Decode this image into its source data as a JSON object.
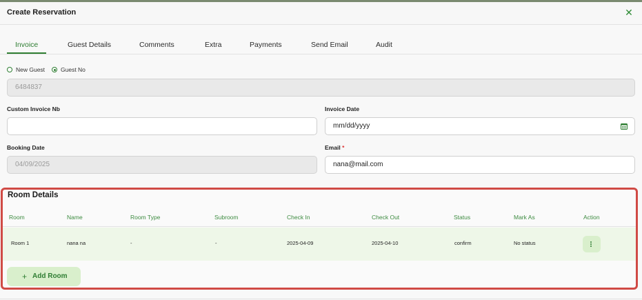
{
  "dialog": {
    "title": "Create Reservation",
    "close_symbol": "✕"
  },
  "tabs": [
    {
      "label": "Invoice",
      "active": true
    },
    {
      "label": "Guest Details",
      "active": false
    },
    {
      "label": "Comments",
      "active": false
    },
    {
      "label": "Extra",
      "active": false
    },
    {
      "label": "Payments",
      "active": false
    },
    {
      "label": "Send Email",
      "active": false
    },
    {
      "label": "Audit",
      "active": false
    }
  ],
  "guest_type": {
    "options": [
      "New Guest",
      "Guest No"
    ],
    "selected": "Guest No"
  },
  "form": {
    "guest_no": {
      "value": "6484837"
    },
    "custom_invoice_nb": {
      "label": "Custom Invoice Nb",
      "value": ""
    },
    "invoice_date": {
      "label": "Invoice Date",
      "value": "mm/dd/yyyy"
    },
    "booking_date": {
      "label": "Booking Date",
      "value": "04/09/2025"
    },
    "email": {
      "label": "Email",
      "required_mark": "*",
      "value": "nana@mail.com"
    }
  },
  "room_details": {
    "title": "Room Details",
    "columns": [
      "Room",
      "Name",
      "Room Type",
      "Subroom",
      "Check In",
      "Check Out",
      "Status",
      "Mark As",
      "Action"
    ],
    "rows": [
      {
        "room": "Room 1",
        "name": "nana na",
        "room_type": "-",
        "subroom": "-",
        "check_in": "2025-04-09",
        "check_out": "2025-04-10",
        "status": "confirm",
        "mark_as": "No status"
      }
    ],
    "add_button": {
      "icon": "+",
      "label": "Add Room"
    }
  },
  "colors": {
    "accent": "#2e7d32",
    "highlight_border": "#d04a45",
    "row_bg": "#eef7e8"
  }
}
